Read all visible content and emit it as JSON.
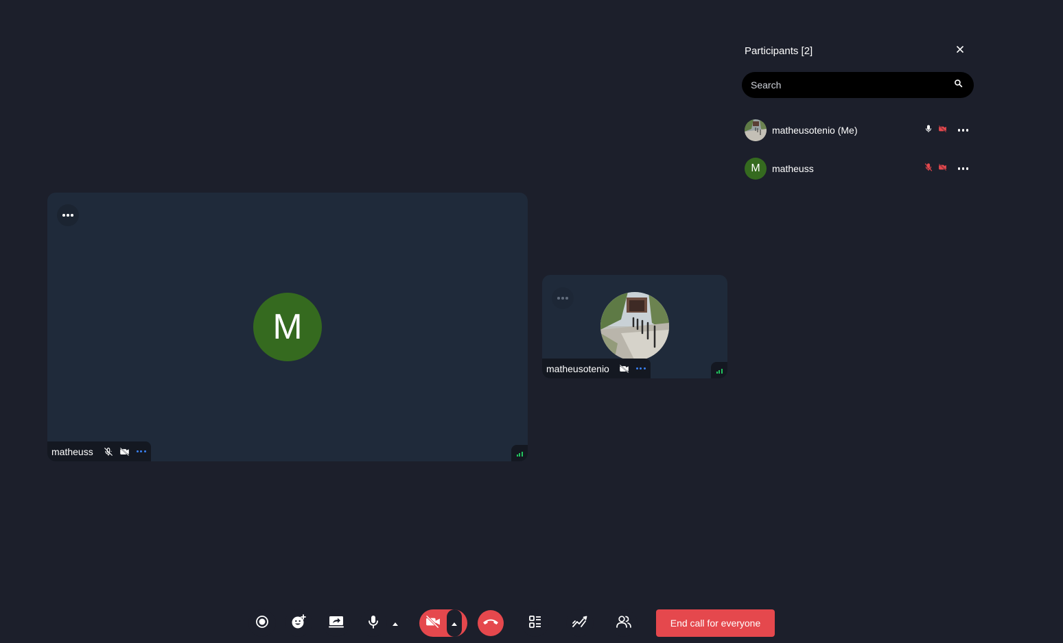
{
  "main_tile": {
    "avatar_letter": "M",
    "name": "matheuss",
    "avatar_color": "#356a1f"
  },
  "small_tile": {
    "name": "matheusotenio"
  },
  "participants": {
    "title": "Participants [2]",
    "search_placeholder": "Search",
    "list": [
      {
        "name": "matheusotenio (Me)",
        "avatar": "photo",
        "mic": "on",
        "camera": "off"
      },
      {
        "name": "matheuss",
        "avatar_letter": "M",
        "mic": "off",
        "camera": "off"
      }
    ]
  },
  "controls": {
    "end_call_for_everyone": "End call for everyone",
    "icons": [
      "record-icon",
      "reaction-icon",
      "share-screen-icon",
      "microphone-icon",
      "chevron-up-icon",
      "camera-off-icon",
      "chevron-up-icon",
      "hang-up-icon",
      "layout-icon",
      "whiteboard-icon",
      "participants-icon"
    ]
  },
  "colors": {
    "background": "#1c1f2b",
    "tile": "#1f2a3a",
    "danger": "#e5484d",
    "avatar_green": "#356a1f",
    "signal_green": "#22c55e",
    "accent_blue": "#3b82f6"
  }
}
